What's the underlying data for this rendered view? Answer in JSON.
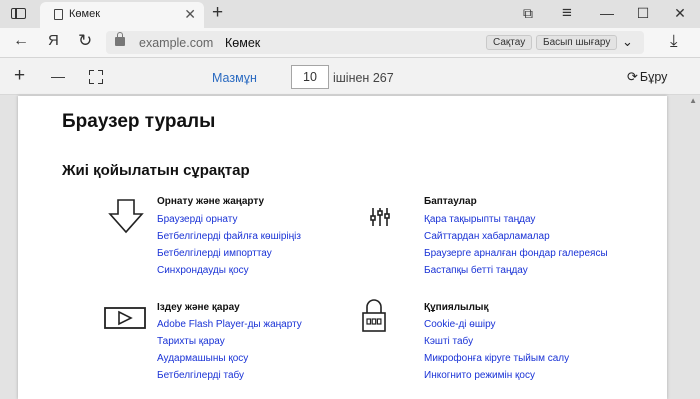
{
  "tab": {
    "title": "Көмек",
    "close": "✕",
    "new_tab": "+"
  },
  "window_controls": {
    "bookmarks": "⧉",
    "menu": "≡",
    "minimize": "—",
    "maximize": "☐",
    "close": "✕"
  },
  "nav": {
    "back": "←",
    "yandex": "Я",
    "reload": "↻"
  },
  "address": {
    "domain": "example.com",
    "page_title": "Көмек",
    "save_label": "Сақтау",
    "print_label": "Басып шығару",
    "chevron": "⌄",
    "download": "⤓"
  },
  "pdf_toolbar": {
    "zoom_in": "+",
    "zoom_out": "—",
    "toc_label": "Мазмұн",
    "page_number": "10",
    "page_of": "ішінен 267",
    "rotate_icon": "⟳",
    "rotate_label": "Бұру"
  },
  "doc": {
    "heading": "Браузер туралы",
    "subheading": "Жиі қойылатын сұрақтар",
    "sections": [
      {
        "icon": "download-arrow-icon",
        "title": "Орнату және жаңарту",
        "links": [
          "Браузерді орнату",
          "Бетбелгілерді файлға көшіріңіз",
          "Бетбелгілерді импорттау",
          "Синхрондауды қосу"
        ]
      },
      {
        "icon": "sliders-icon",
        "title": "Баптаулар",
        "links": [
          "Қара тақырыпты таңдау",
          "Сайттардан хабарламалар",
          "Браузерге арналған фондар галереясы",
          "Бастапқы бетті таңдау"
        ]
      },
      {
        "icon": "video-play-icon",
        "title": "Іздеу және қарау",
        "links": [
          "Adobe Flash Player-ды жаңарту",
          "Тарихты қарау",
          "Аудармашыны қосу",
          "Бетбелгілерді табу"
        ]
      },
      {
        "icon": "padlock-icon",
        "title": "Құпиялылық",
        "links": [
          "Cookie-ді өшіру",
          "Кэшті табу",
          "Микрофонға кіруге тыйым салу",
          "Инкогнито режимін қосу"
        ]
      }
    ]
  },
  "colors": {
    "link": "#1a33d6",
    "toc_link": "#2a6ac1"
  }
}
